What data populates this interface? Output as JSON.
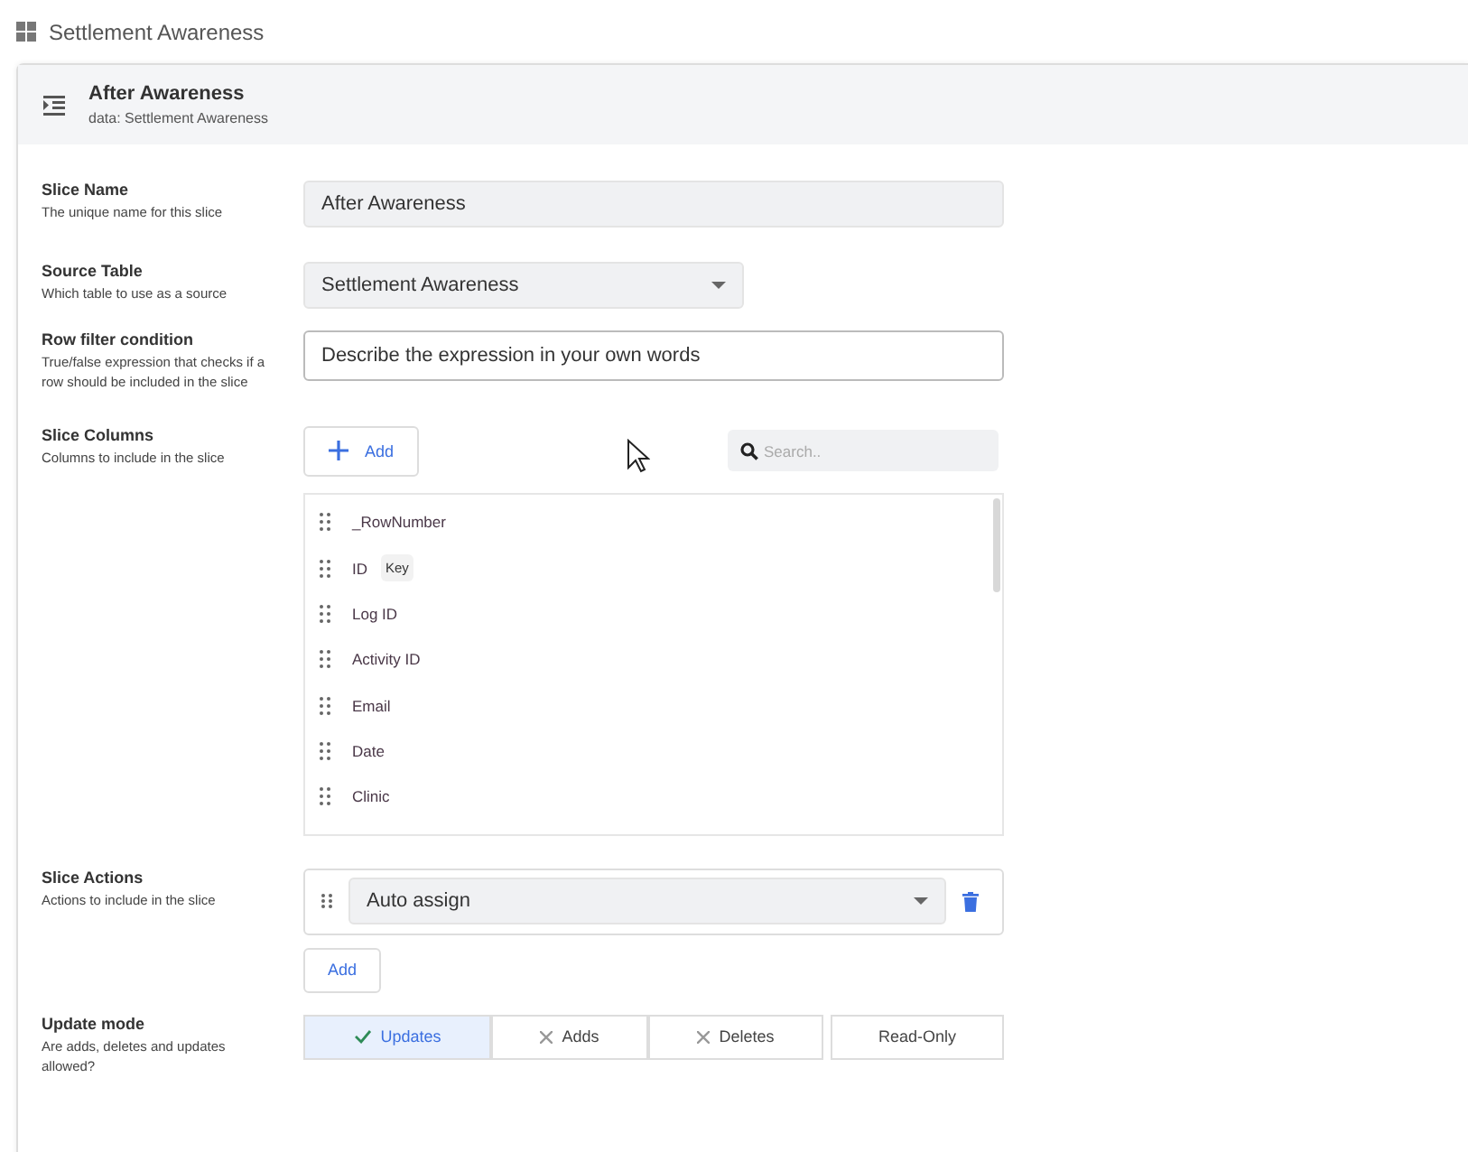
{
  "app_bar": {
    "title": "Settlement Awareness"
  },
  "header": {
    "title": "After Awareness",
    "subtitle": "data: Settlement Awareness"
  },
  "slice_name": {
    "label": "Slice Name",
    "help": "The unique name for this slice",
    "value": "After Awareness"
  },
  "source_table": {
    "label": "Source Table",
    "help": "Which table to use as a source",
    "value": "Settlement Awareness"
  },
  "row_filter": {
    "label": "Row filter condition",
    "help": "True/false expression that checks if a row should be included in the slice",
    "placeholder": "Describe the expression in your own words"
  },
  "slice_columns": {
    "label": "Slice Columns",
    "help": "Columns to include in the slice",
    "add_button": "Add",
    "search_placeholder": "Search..",
    "columns": [
      {
        "name": "_RowNumber"
      },
      {
        "name": "ID",
        "badge": "Key"
      },
      {
        "name": "Log ID"
      },
      {
        "name": "Activity ID"
      },
      {
        "name": "Email"
      },
      {
        "name": "Date"
      },
      {
        "name": "Clinic"
      }
    ]
  },
  "slice_actions": {
    "label": "Slice Actions",
    "help": "Actions to include in the slice",
    "actions": [
      {
        "value": "Auto assign"
      }
    ],
    "add_button": "Add"
  },
  "update_mode": {
    "label": "Update mode",
    "help": "Are adds, deletes and updates allowed?",
    "options": [
      {
        "label": "Updates",
        "kind": "toggle",
        "selected": true
      },
      {
        "label": "Adds",
        "kind": "toggle",
        "selected": false
      },
      {
        "label": "Deletes",
        "kind": "toggle",
        "selected": false
      },
      {
        "label": "Read-Only",
        "kind": "plain",
        "selected": false
      }
    ]
  }
}
